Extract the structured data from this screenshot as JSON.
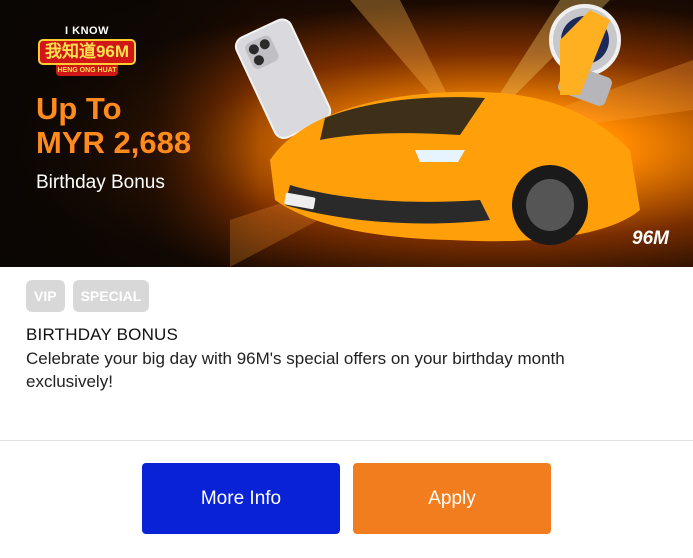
{
  "banner": {
    "logo": {
      "top_text": "I KNOW",
      "main_text": "我知道96M",
      "bottom_text": "HENG ONG HUAT"
    },
    "headline_line1": "Up To",
    "headline_line2": "MYR 2,688",
    "subline": "Birthday Bonus",
    "watermark": "96M",
    "image_subjects": [
      "smartphone",
      "luxury-watch",
      "orange-sports-car"
    ]
  },
  "tags": [
    "VIP",
    "SPECIAL"
  ],
  "promo": {
    "title": "BIRTHDAY BONUS",
    "description": "Celebrate your big day with 96M's special offers on your birthday month exclusively!"
  },
  "actions": {
    "more_info_label": "More Info",
    "apply_label": "Apply"
  },
  "colors": {
    "accent_orange": "#f27d1f",
    "more_info_blue": "#0a22d6",
    "tag_gray": "#d8d8d8",
    "headline_orange": "#ff8a1e"
  }
}
